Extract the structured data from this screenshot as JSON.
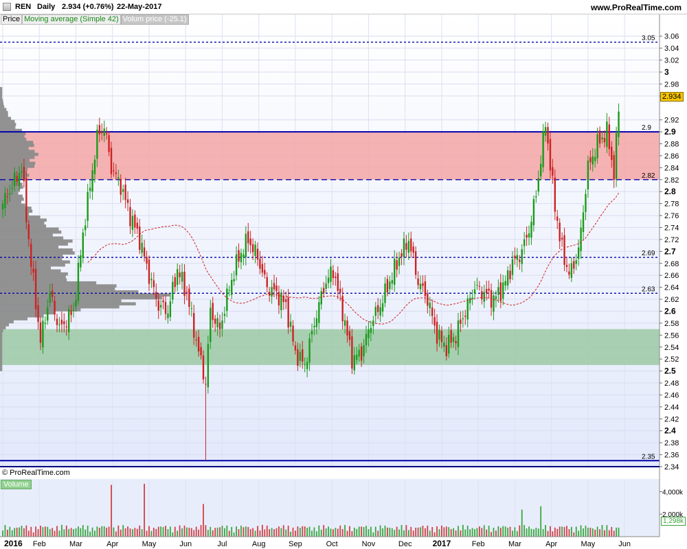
{
  "header": {
    "symbol": "REN",
    "period": "Daily",
    "price_change": "2.934 (+0.76%)",
    "date": "22-May-2017",
    "website": "www.ProRealTime.com"
  },
  "legend": {
    "price": "Price",
    "moving_average": "Moving average (Simple 42)",
    "volume_profile": "Volum price (-25.1)"
  },
  "copyright": "© ProRealTime.com",
  "volume_panel": {
    "label": "Volume",
    "last_value": "1,298k"
  },
  "last_price_label": "2.934",
  "colors": {
    "up": "#1a9a1a",
    "down": "#cc2222",
    "resistance_zone": "#f4a6a6",
    "support_zone": "#9cc9a3",
    "profile": "#8c8c8c",
    "level_line": "#0000aa",
    "ma": "#cc2222",
    "background": "#ebf0ff"
  },
  "chart_data": {
    "type": "candlestick",
    "y_range": [
      2.34,
      3.07
    ],
    "y_ticks": [
      "3.06",
      "3.04",
      "3.02",
      "3",
      "2.98",
      "2.96",
      "2.92",
      "2.9",
      "2.88",
      "2.86",
      "2.84",
      "2.82",
      "2.8",
      "2.78",
      "2.76",
      "2.74",
      "2.72",
      "2.7",
      "2.68",
      "2.66",
      "2.64",
      "2.62",
      "2.6",
      "2.58",
      "2.56",
      "2.54",
      "2.52",
      "2.5",
      "2.48",
      "2.46",
      "2.44",
      "2.42",
      "2.4",
      "2.38",
      "2.36",
      "2.34"
    ],
    "x_labels": [
      "2016",
      "Feb",
      "Mar",
      "Apr",
      "May",
      "Jun",
      "Jul",
      "Aug",
      "Sep",
      "Oct",
      "Nov",
      "Dec",
      "2017",
      "Feb",
      "Mar",
      "Apr",
      "May",
      "Jun"
    ],
    "level_lines": [
      {
        "value": 3.05,
        "label": "3.05",
        "style": "dotted"
      },
      {
        "value": 2.9,
        "label": "2.9",
        "style": "solid"
      },
      {
        "value": 2.82,
        "label": "2.82",
        "style": "dashed"
      },
      {
        "value": 2.69,
        "label": "2.69",
        "style": "dotted"
      },
      {
        "value": 2.63,
        "label": "2.63",
        "style": "dotted"
      },
      {
        "value": 2.35,
        "label": "2.35",
        "style": "solid"
      }
    ],
    "zones": [
      {
        "from": 2.82,
        "to": 2.9,
        "kind": "resistance"
      },
      {
        "from": 2.51,
        "to": 2.57,
        "kind": "support"
      }
    ],
    "close_path": [
      [
        0,
        2.78
      ],
      [
        8,
        2.84
      ],
      [
        12,
        2.68
      ],
      [
        16,
        2.55
      ],
      [
        20,
        2.63
      ],
      [
        24,
        2.57
      ],
      [
        30,
        2.6
      ],
      [
        34,
        2.73
      ],
      [
        40,
        2.89
      ],
      [
        43,
        2.91
      ],
      [
        46,
        2.84
      ],
      [
        50,
        2.81
      ],
      [
        54,
        2.76
      ],
      [
        58,
        2.72
      ],
      [
        62,
        2.66
      ],
      [
        66,
        2.61
      ],
      [
        70,
        2.6
      ],
      [
        74,
        2.67
      ],
      [
        78,
        2.63
      ],
      [
        82,
        2.55
      ],
      [
        86,
        2.48
      ],
      [
        88,
        2.6
      ],
      [
        92,
        2.57
      ],
      [
        96,
        2.64
      ],
      [
        100,
        2.69
      ],
      [
        104,
        2.72
      ],
      [
        108,
        2.69
      ],
      [
        112,
        2.64
      ],
      [
        116,
        2.63
      ],
      [
        120,
        2.61
      ],
      [
        124,
        2.53
      ],
      [
        128,
        2.51
      ],
      [
        132,
        2.58
      ],
      [
        136,
        2.64
      ],
      [
        140,
        2.67
      ],
      [
        144,
        2.6
      ],
      [
        148,
        2.52
      ],
      [
        152,
        2.53
      ],
      [
        156,
        2.58
      ],
      [
        160,
        2.61
      ],
      [
        164,
        2.65
      ],
      [
        168,
        2.69
      ],
      [
        172,
        2.72
      ],
      [
        176,
        2.65
      ],
      [
        180,
        2.62
      ],
      [
        184,
        2.56
      ],
      [
        188,
        2.54
      ],
      [
        192,
        2.56
      ],
      [
        196,
        2.6
      ],
      [
        200,
        2.64
      ],
      [
        204,
        2.63
      ],
      [
        208,
        2.62
      ],
      [
        212,
        2.64
      ],
      [
        216,
        2.68
      ],
      [
        220,
        2.7
      ],
      [
        224,
        2.75
      ],
      [
        228,
        2.85
      ],
      [
        230,
        2.92
      ],
      [
        232,
        2.84
      ],
      [
        236,
        2.72
      ],
      [
        240,
        2.66
      ],
      [
        244,
        2.7
      ],
      [
        248,
        2.84
      ],
      [
        252,
        2.88
      ],
      [
        256,
        2.9
      ],
      [
        259,
        2.83
      ],
      [
        261,
        2.934
      ]
    ],
    "sma_start": 36,
    "sma_end_value": 2.79,
    "volume_peaks": [
      {
        "x": "Apr 2016",
        "value": 4600
      },
      {
        "x": "May 2016",
        "value": 4700
      },
      {
        "x": "Jul 2016",
        "value": 2900
      },
      {
        "x": "Mar 2017",
        "value": 2400
      },
      {
        "x": "Apr 2017",
        "value": 2700
      }
    ],
    "volume_ticks": [
      "4,000k",
      "2,000k"
    ],
    "profile_note": "volume at price histogram on left edge, largest near 2.62"
  }
}
